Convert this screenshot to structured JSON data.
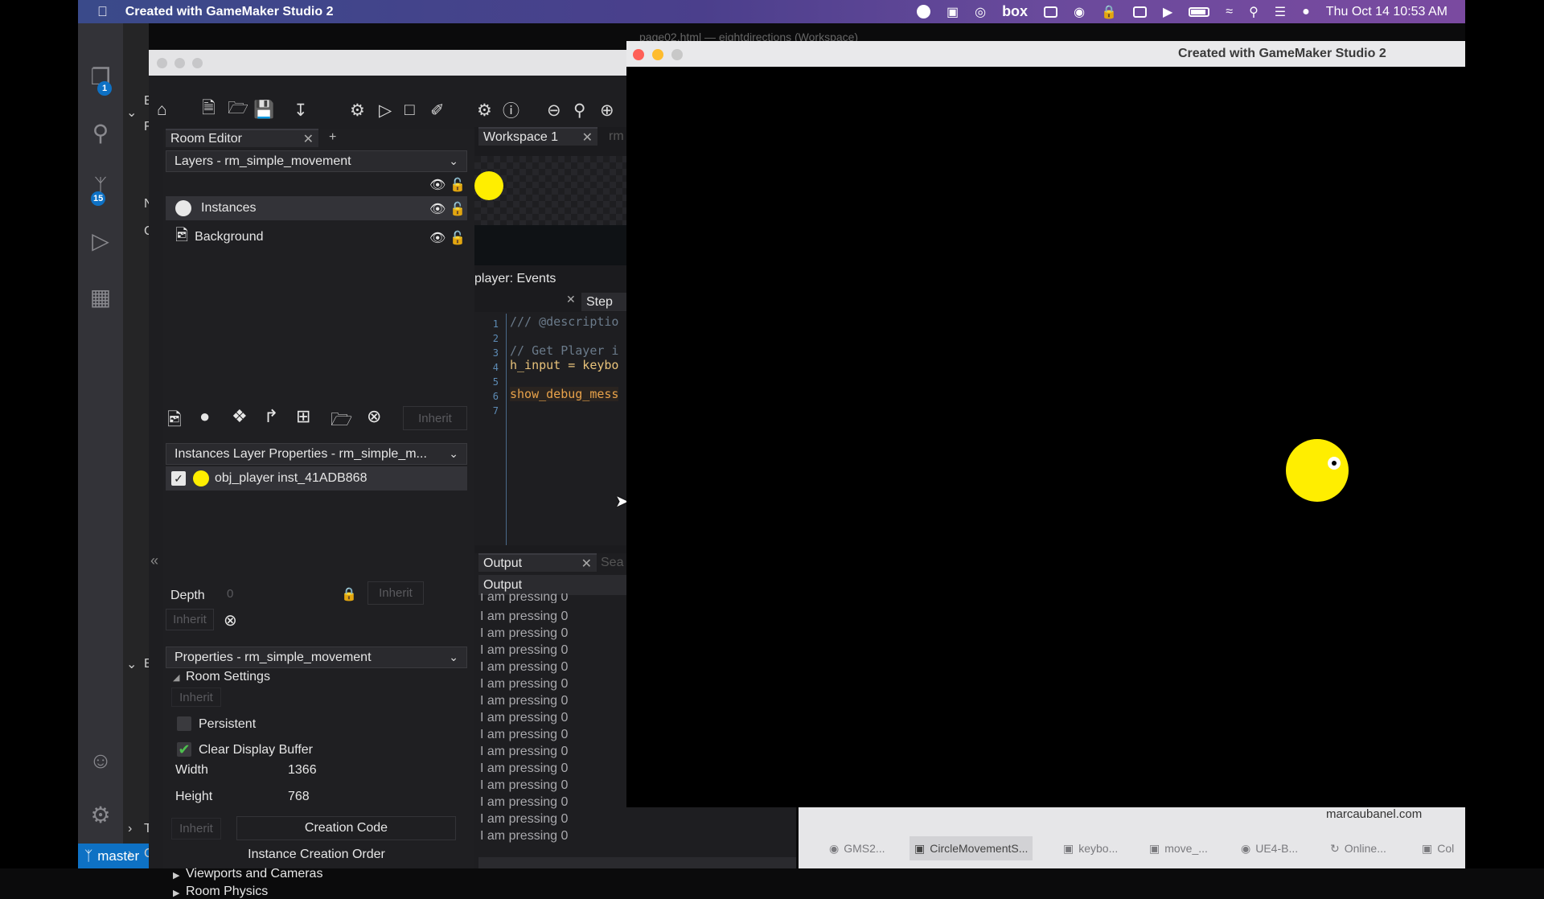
{
  "menubar": {
    "app_title": "Created with GameMaker Studio 2",
    "datetime": "Thu Oct 14  10:53 AM",
    "brand": "box"
  },
  "activity_bar": {
    "explorer_badge": "1",
    "source_control_badge": "15"
  },
  "status_bar": {
    "branch": "master"
  },
  "vs_side_letters": [
    "E",
    "F",
    "N",
    "C",
    "E",
    "T",
    "C"
  ],
  "gm_toolbar": {
    "icons": [
      "home-icon",
      "new-file-icon",
      "open-folder-icon",
      "save-icon",
      "export-icon",
      "debug-icon",
      "run-icon",
      "stop-icon",
      "clean-icon",
      "settings-icon",
      "help-icon",
      "zoom-out-icon",
      "zoom-reset-icon",
      "zoom-in-icon"
    ]
  },
  "room_editor": {
    "tab_label": "Room Editor",
    "tab_plus": "+",
    "layers_dropdown": "Layers - rm_simple_movement",
    "layers": [
      {
        "name": "Instances",
        "icon": "instance-layer-icon",
        "selected": true
      },
      {
        "name": "Background",
        "icon": "background-layer-icon",
        "selected": false
      }
    ],
    "layer_buttons_inherit": "Inherit",
    "instances_dropdown": "Instances Layer Properties - rm_simple_m...",
    "instance_item": "obj_player  inst_41ADB868",
    "collapse_glyph": "«",
    "depth_label": "Depth",
    "depth_value": "0",
    "depth_inherit": "Inherit",
    "inherit2": "Inherit",
    "properties_dropdown": "Properties - rm_simple_movement",
    "room_settings": "Room Settings",
    "room_settings_inherit": "Inherit",
    "persistent_label": "Persistent",
    "clear_display_label": "Clear Display Buffer",
    "width_label": "Width",
    "width_value": "1366",
    "height_label": "Height",
    "height_value": "768",
    "creation_inherit": "Inherit",
    "creation_code": "Creation Code",
    "instance_creation_order": "Instance Creation Order",
    "viewports": "Viewports and Cameras",
    "room_physics": "Room Physics"
  },
  "workspace": {
    "tab_label": "Workspace 1",
    "next_tab": "rm",
    "events_title": "player: Events",
    "step_tab": "Step",
    "line_numbers": [
      "1",
      "2",
      "3",
      "4",
      "5",
      "6",
      "7"
    ],
    "code_lines": [
      {
        "text": "/// @descriptio",
        "color": "#6a7a8a"
      },
      {
        "text": "",
        "color": "#6a7a8a"
      },
      {
        "text": "// Get Player i",
        "color": "#6a7a8a"
      },
      {
        "text": "h_input = keybo",
        "color": "#e8c27a"
      },
      {
        "text": "",
        "color": "#6a7a8a"
      },
      {
        "text": "show_debug_mess",
        "color": "#e8a24a"
      },
      {
        "text": "",
        "color": "#6a7a8a"
      }
    ]
  },
  "output": {
    "tab_label": "Output",
    "search_tab": "Sea",
    "header": "Output",
    "partial_line": "I am pressing 0",
    "lines": [
      "I am pressing 0",
      "I am pressing 0",
      "I am pressing 0",
      "I am pressing 0",
      "I am pressing 0",
      "I am pressing 0",
      "I am pressing 0",
      "I am pressing 0",
      "I am pressing 0",
      "I am pressing 0",
      "I am pressing 0",
      "I am pressing 0",
      "I am pressing 0",
      "I am pressing 0",
      "I am pressing 0"
    ]
  },
  "behind_window_title": "page02.html — eightdirections (Workspace)",
  "game_window": {
    "title": "Created with GameMaker Studio 2",
    "player_color": "#ffee00"
  },
  "browser": {
    "url": "marcaubanel.com",
    "tabs": [
      {
        "label": "GMS2...",
        "icon": "github-icon"
      },
      {
        "label": "CircleMovementS...",
        "icon": "gamemaker-icon"
      },
      {
        "label": "keybo...",
        "icon": "gamemaker-icon"
      },
      {
        "label": "move_...",
        "icon": "gamemaker-icon"
      },
      {
        "label": "UE4-B...",
        "icon": "github-icon"
      },
      {
        "label": "Online...",
        "icon": "loading-icon"
      },
      {
        "label": "Col",
        "icon": "site-icon"
      }
    ]
  }
}
